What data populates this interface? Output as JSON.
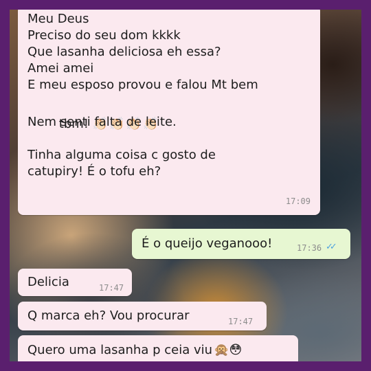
{
  "colors": {
    "incoming_bubble": "#fbe9ef",
    "outgoing_bubble": "#e7f7d2",
    "read_ticks": "#4fa3e0",
    "frame": "#5a1f6e"
  },
  "messages": [
    {
      "direction": "incoming",
      "lines": [
        "Meu Deus",
        "Preciso do seu dom kkkk",
        "Que lasanha deliciosa eh essa?",
        "Amei amei",
        "E meu esposo provou e falou Mt bem"
      ],
      "line6_text": "tbm! ",
      "line6_emoji": "👏🏻👏🏻👏🏻👏🏻",
      "lines_after": [
        "Nem senti falta de leite.",
        "",
        "Tinha alguma coisa c gosto de",
        "catupiry! É o tofu eh?"
      ],
      "time": "17:09"
    },
    {
      "direction": "outgoing",
      "text": "É o queijo veganooo!",
      "time": "17:36",
      "ticks": "✓✓",
      "status": "read"
    },
    {
      "direction": "incoming",
      "text": "Delicia",
      "time": "17:47"
    },
    {
      "direction": "incoming",
      "text": "Q marca eh? Vou procurar",
      "time": "17:47"
    },
    {
      "direction": "incoming",
      "text": "Quero uma lasanha p ceia viu",
      "emoji": "🙊😳"
    }
  ]
}
